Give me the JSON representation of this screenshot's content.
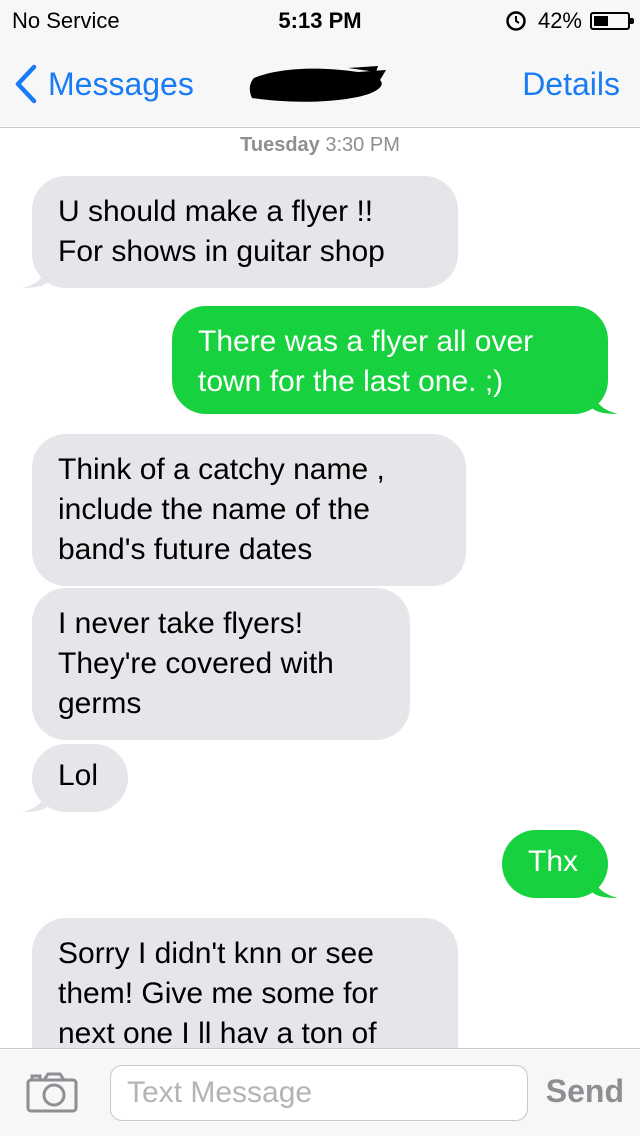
{
  "status_bar": {
    "carrier": "No Service",
    "time": "5:13 PM",
    "battery_percent": "42%",
    "icons": [
      "alarm-icon",
      "battery-icon"
    ]
  },
  "nav_bar": {
    "back_label": "Messages",
    "details_label": "Details",
    "contact_name": "[redacted]",
    "icons": [
      "chevron-left-icon"
    ]
  },
  "conversation": {
    "timestamp_day": "Tuesday",
    "timestamp_time": "3:30 PM",
    "messages": [
      {
        "direction": "incoming",
        "lines": [
          "U should make a flyer !!",
          "For shows in guitar shop"
        ]
      },
      {
        "direction": "outgoing",
        "lines": [
          "There was a flyer all over",
          "town for the last one. ;)"
        ]
      },
      {
        "direction": "incoming",
        "lines": [
          "Think of a catchy name ,",
          "include the name of the",
          "band's future dates"
        ]
      },
      {
        "direction": "incoming",
        "lines": [
          "I never take flyers!",
          "They're covered with",
          "germs"
        ]
      },
      {
        "direction": "incoming",
        "lines": [
          "Lol"
        ]
      },
      {
        "direction": "outgoing",
        "lines": [
          "Thx"
        ]
      },
      {
        "direction": "incoming",
        "lines": [
          "Sorry I didn't knn or see",
          "them! Give me some for",
          "next one I ll hav a ton of"
        ]
      }
    ]
  },
  "input_bar": {
    "placeholder": "Text Message",
    "value": "",
    "send_label": "Send",
    "icons": [
      "camera-icon"
    ]
  },
  "colors": {
    "accent_blue": "#1a7cf4",
    "outgoing_bubble": "#17d13f",
    "incoming_bubble": "#e5e5ea",
    "bar_background": "#f7f7f7"
  }
}
